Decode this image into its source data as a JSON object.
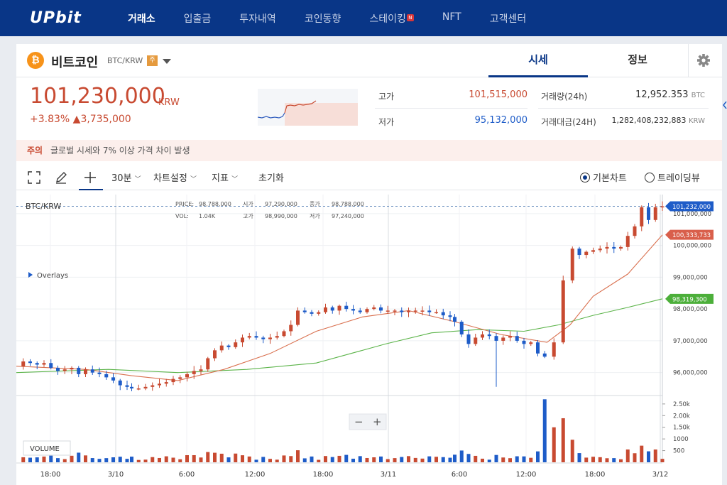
{
  "nav": {
    "logo": "UPbit",
    "items": [
      {
        "label": "거래소",
        "active": true
      },
      {
        "label": "입출금"
      },
      {
        "label": "투자내역"
      },
      {
        "label": "코인동향"
      },
      {
        "label": "스테이킹",
        "badge": "N"
      },
      {
        "label": "NFT"
      },
      {
        "label": "고객센터"
      }
    ]
  },
  "coin": {
    "name": "비트코인",
    "pair": "BTC/KRW",
    "warning_badge": "주",
    "icon_letter": "₿",
    "price": "101,230,000",
    "price_unit": "KRW",
    "change_pct": "+3.83%",
    "change_amt": "▲3,735,000"
  },
  "tabs": {
    "sise": "시세",
    "info": "정보"
  },
  "stats": {
    "high_label": "고가",
    "high": "101,515,000",
    "low_label": "저가",
    "low": "95,132,000",
    "volume_label": "거래량(24h)",
    "volume": "12,952.353",
    "volume_unit": "BTC",
    "value_label": "거래대금(24H)",
    "value": "1,282,408,232,883",
    "value_unit": "KRW"
  },
  "notice": {
    "tag": "주의",
    "text": "글로벌 시세와 7% 이상 가격 차이 발생"
  },
  "toolbar": {
    "interval": "30분",
    "chart_settings": "차트설정",
    "indicators": "지표",
    "reset": "초기화",
    "basic_chart": "기본차트",
    "tradingview": "트레이딩뷰"
  },
  "chart_data": {
    "type": "candlestick",
    "symbol": "BTC/KRW",
    "overlays_label": "Overlays",
    "legend": {
      "price_label": "PRICE:",
      "price": "98,788,000",
      "open_label": "시가",
      "open": "97,290,000",
      "close_label": "종가",
      "close": "98,788,000",
      "vol_label": "VOL:",
      "vol": "1.04K",
      "high_label": "고가",
      "high": "98,990,000",
      "low_label": "저가",
      "low": "97,240,000"
    },
    "y_ticks": [
      "101,000,000",
      "100,000,000",
      "99,000,000",
      "98,000,000",
      "97,000,000",
      "96,000,000"
    ],
    "y_tick_values": [
      101000000,
      100000000,
      99000000,
      98000000,
      97000000,
      96000000
    ],
    "y_range": [
      95300000,
      101600000
    ],
    "price_tags": [
      {
        "label": "101,232,000",
        "value": 101232000,
        "color": "#1e5cc8"
      },
      {
        "label": "100,333,733",
        "value": 100333733,
        "color": "#d95f4b"
      },
      {
        "label": "98,319,300",
        "value": 98319300,
        "color": "#4caf3a"
      }
    ],
    "x_ticks": [
      "18:00",
      "3/10",
      "6:00",
      "12:00",
      "18:00",
      "3/11",
      "6:00",
      "12:00",
      "18:00",
      "3/12"
    ],
    "volume_label": "VOLUME",
    "volume_ticks": [
      "2.50k",
      "2.00k",
      "1.50k",
      "1000",
      "500"
    ],
    "volume_tick_values": [
      2500,
      2000,
      1500,
      1000,
      500
    ],
    "volume_range": [
      0,
      2800
    ],
    "close_points": [
      [
        0,
        96.2
      ],
      [
        6,
        96.35
      ],
      [
        12,
        96.3
      ],
      [
        18,
        96.25
      ],
      [
        24,
        96.3
      ],
      [
        30,
        96.15
      ],
      [
        36,
        96.05
      ],
      [
        42,
        96.1
      ],
      [
        48,
        96.15
      ],
      [
        54,
        95.95
      ],
      [
        60,
        96.1
      ],
      [
        66,
        96.0
      ],
      [
        72,
        95.95
      ],
      [
        78,
        95.85
      ],
      [
        84,
        95.75
      ],
      [
        90,
        95.6
      ],
      [
        96,
        95.55
      ],
      [
        100,
        95.5
      ],
      [
        106,
        95.5
      ],
      [
        112,
        95.55
      ],
      [
        118,
        95.6
      ],
      [
        124,
        95.65
      ],
      [
        130,
        95.7
      ],
      [
        136,
        95.8
      ],
      [
        142,
        95.85
      ],
      [
        148,
        95.95
      ],
      [
        154,
        96.05
      ],
      [
        160,
        96.1
      ],
      [
        166,
        96.45
      ],
      [
        172,
        96.7
      ],
      [
        178,
        96.85
      ],
      [
        184,
        96.8
      ],
      [
        190,
        96.95
      ],
      [
        196,
        97.1
      ],
      [
        202,
        97.15
      ],
      [
        208,
        97.1
      ],
      [
        214,
        97.05
      ],
      [
        220,
        97.1
      ],
      [
        226,
        97.15
      ],
      [
        232,
        97.3
      ],
      [
        238,
        97.5
      ],
      [
        244,
        97.95
      ],
      [
        250,
        97.9
      ],
      [
        256,
        97.85
      ],
      [
        262,
        97.9
      ],
      [
        268,
        98.05
      ],
      [
        274,
        97.95
      ],
      [
        280,
        98.1
      ],
      [
        286,
        98.0
      ],
      [
        292,
        97.95
      ],
      [
        298,
        97.9
      ],
      [
        304,
        98.0
      ],
      [
        310,
        98.05
      ],
      [
        316,
        97.95
      ],
      [
        322,
        97.95
      ],
      [
        328,
        97.95
      ],
      [
        334,
        97.9
      ],
      [
        340,
        97.95
      ],
      [
        346,
        97.95
      ],
      [
        352,
        97.95
      ],
      [
        358,
        97.9
      ],
      [
        364,
        97.9
      ],
      [
        370,
        97.8
      ],
      [
        376,
        97.75
      ],
      [
        380,
        97.6
      ],
      [
        386,
        97.2
      ],
      [
        392,
        96.9
      ],
      [
        398,
        97.1
      ],
      [
        404,
        97.2
      ],
      [
        410,
        97.15
      ],
      [
        416,
        97.0
      ],
      [
        422,
        97.1
      ],
      [
        428,
        97.15
      ],
      [
        434,
        97.0
      ],
      [
        440,
        96.9
      ],
      [
        446,
        96.95
      ],
      [
        452,
        96.6
      ],
      [
        458,
        96.5
      ],
      [
        466,
        96.95
      ],
      [
        474,
        98.9
      ],
      [
        482,
        99.9
      ],
      [
        488,
        99.7
      ],
      [
        494,
        99.8
      ],
      [
        500,
        99.85
      ],
      [
        506,
        99.9
      ],
      [
        512,
        99.95
      ],
      [
        518,
        99.9
      ],
      [
        524,
        99.95
      ],
      [
        530,
        100.3
      ],
      [
        536,
        100.6
      ],
      [
        542,
        101.2
      ],
      [
        548,
        100.8
      ],
      [
        554,
        101.2
      ],
      [
        560,
        101.23
      ]
    ],
    "ma_red": [
      [
        0,
        96.2
      ],
      [
        60,
        96.1
      ],
      [
        100,
        95.9
      ],
      [
        140,
        95.75
      ],
      [
        180,
        96.1
      ],
      [
        220,
        96.6
      ],
      [
        260,
        97.3
      ],
      [
        300,
        97.75
      ],
      [
        340,
        97.95
      ],
      [
        380,
        97.6
      ],
      [
        420,
        97.2
      ],
      [
        460,
        96.95
      ],
      [
        480,
        97.5
      ],
      [
        500,
        98.4
      ],
      [
        530,
        99.1
      ],
      [
        560,
        100.33
      ]
    ],
    "ma_green": [
      [
        0,
        96.0
      ],
      [
        80,
        96.1
      ],
      [
        140,
        96.0
      ],
      [
        200,
        96.1
      ],
      [
        260,
        96.3
      ],
      [
        320,
        96.9
      ],
      [
        360,
        97.25
      ],
      [
        400,
        97.35
      ],
      [
        440,
        97.3
      ],
      [
        470,
        97.5
      ],
      [
        500,
        97.8
      ],
      [
        530,
        98.05
      ],
      [
        560,
        98.32
      ]
    ]
  }
}
